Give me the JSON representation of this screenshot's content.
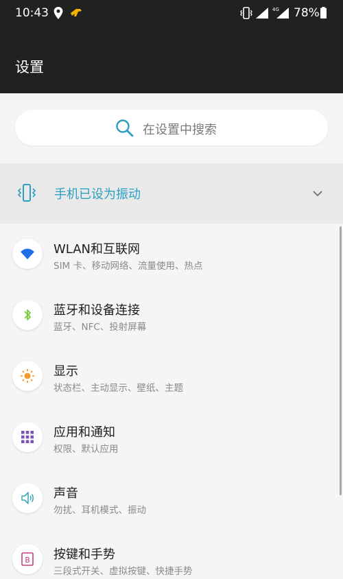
{
  "status_bar": {
    "time": "10:43",
    "battery_percent": "78%",
    "network_badge": "4G",
    "icons": [
      "location-icon",
      "app-notification-icon",
      "vibrate-icon",
      "signal-icon",
      "signal-4g-icon",
      "battery-icon"
    ]
  },
  "header": {
    "title": "设置"
  },
  "search": {
    "placeholder": "在设置中搜索",
    "icon": "search-icon"
  },
  "ring_mode": {
    "label": "手机已设为振动",
    "icon": "vibrate-mode-icon"
  },
  "menu": {
    "items": [
      {
        "title": "WLAN和互联网",
        "subtitle": "SIM 卡、移动网络、流量使用、热点",
        "icon": "wifi-icon",
        "color": "#1e6fe6"
      },
      {
        "title": "蓝牙和设备连接",
        "subtitle": "蓝牙、NFC、投射屏幕",
        "icon": "bluetooth-icon",
        "color": "#7cc63e"
      },
      {
        "title": "显示",
        "subtitle": "状态栏、主动显示、壁纸、主题",
        "icon": "brightness-icon",
        "color": "#f29b2f"
      },
      {
        "title": "应用和通知",
        "subtitle": "权限、默认应用",
        "icon": "apps-grid-icon",
        "color": "#7b52b8"
      },
      {
        "title": "声音",
        "subtitle": "勿扰、耳机模式、振动",
        "icon": "speaker-icon",
        "color": "#3aa7b8"
      },
      {
        "title": "按键和手势",
        "subtitle": "三段式开关、虚拟按键、快捷手势",
        "icon": "buttons-gestures-icon",
        "color": "#c2407a"
      }
    ]
  },
  "colors": {
    "header_bg": "#212121",
    "accent": "#2b9fc2",
    "page_bg": "#f5f5f5"
  }
}
